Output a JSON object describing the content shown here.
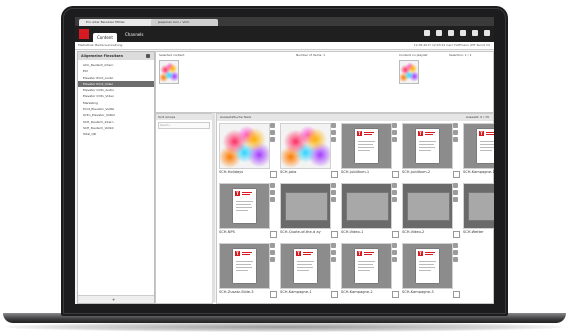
{
  "browser": {
    "tabs": [
      "Ein unter Benutzer  Mfotel",
      "Jeeponen Ann • Vorli."
    ]
  },
  "app": {
    "nav": [
      "Content",
      "Channels"
    ],
    "sub_left": "Mediathek  Medienverwaltung",
    "sub_right": "12.09.2017 12:03:21  Caro Hoffmann  (PIT Kunst Vl)"
  },
  "left_panel": {
    "title": "Allgemeine Flexsitzen",
    "tree": [
      "ACC_Deutsch_Intern",
      "ECI",
      "Elevator Print_Audio",
      "Elevator Print_Video",
      "Elevator Qrltn_Audio",
      "Elevator Qrltn_Video",
      "Marketing",
      "Print_Elevator_Vollbil",
      "Qrltn_Elevator_Vollbil",
      "SCH_Deutsch_Intern",
      "SCH_Deutsch_Vollbil",
      "Total_QR"
    ],
    "selected_index": 3,
    "footer_add": "+"
  },
  "top_strip": {
    "left_label": "Selected content",
    "left_count": "Number of items: 1",
    "right_label": "Content on playlist",
    "right_count": "Selection: 1 / 1"
  },
  "mid_list": {
    "header": "Sort arrows",
    "search_placeholder": "Search..."
  },
  "grid": {
    "header_left": "Auswahl/Suche  Taxis",
    "header_right": "Auswahl: 0 / 15",
    "items": [
      {
        "caption": "SCH-Holidays",
        "kind": "splash"
      },
      {
        "caption": "SCH-Jobs",
        "kind": "splash"
      },
      {
        "caption": "SCH-Jubiläum-1",
        "kind": "page"
      },
      {
        "caption": "SCH-Jubiläum-2",
        "kind": "page"
      },
      {
        "caption": "SCH-Kampagne-1",
        "kind": "page"
      },
      {
        "caption": "SCH-NPS",
        "kind": "page"
      },
      {
        "caption": "SCH-Quote-of-the-d ay",
        "kind": "slide"
      },
      {
        "caption": "SCH-Video-1",
        "kind": "slide"
      },
      {
        "caption": "SCH-Video-2",
        "kind": "slide"
      },
      {
        "caption": "SCH-Wetter",
        "kind": "slide"
      },
      {
        "caption": "SCH-Zusatz-Slide-3",
        "kind": "page"
      },
      {
        "caption": "SCH-Kampagne-1",
        "kind": "page"
      },
      {
        "caption": "SCH-Kampagne-2",
        "kind": "page"
      },
      {
        "caption": "SCH-Kampagne-3",
        "kind": "page"
      }
    ]
  },
  "colors": {
    "brand": "#d71a21",
    "dark_bar": "#1f1f1f"
  }
}
